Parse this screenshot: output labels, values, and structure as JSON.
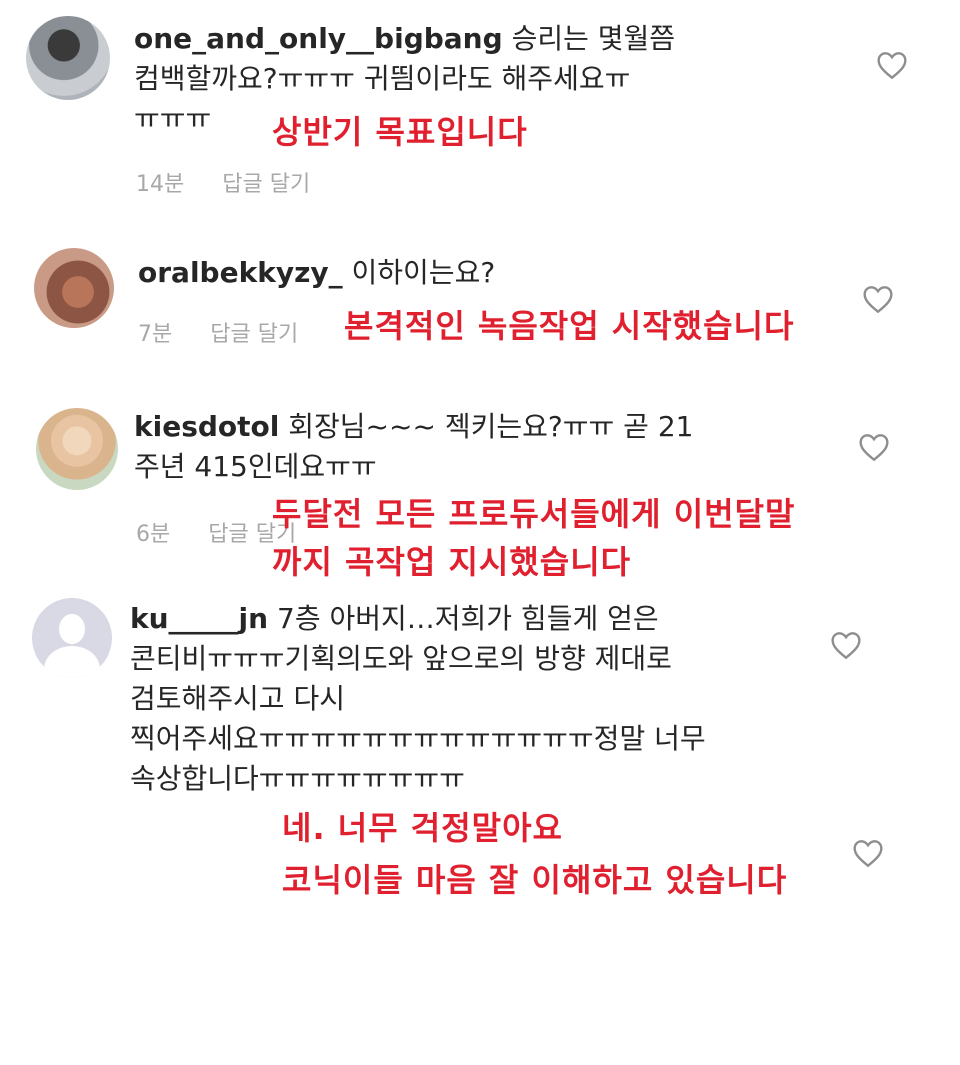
{
  "comments": [
    {
      "username": "one_and_only__bigbang",
      "text_line1": "승리는 몇월쯤",
      "text_line2": "컴백할까요?ㅠㅠㅠ 귀띔이라도 해주세요ㅠ",
      "text_line3": "ㅠㅠㅠ",
      "time": "14분",
      "reply_label": "답글 달기",
      "annotation": "상반기 목표입니다"
    },
    {
      "username": "oralbekkyzy_",
      "text_line1": "이하이는요?",
      "time": "7분",
      "reply_label": "답글 달기",
      "annotation": "본격적인 녹음작업 시작했습니다"
    },
    {
      "username": "kiesdotol",
      "text_line1": "회장님~~~ 젝키는요?ㅠㅠ 곧 21",
      "text_line2": "주년 415인데요ㅠㅠ",
      "time": "6분",
      "reply_label": "답글 달기",
      "annotation_line1": "두달전 모든 프로듀서들에게 이번달말",
      "annotation_line2": "까지 곡작업 지시했습니다"
    },
    {
      "username": "ku_____jn",
      "text_line1": "7층 아버지…저희가 힘들게 얻은",
      "text_line2": "콘티비ㅠㅠㅠ기획의도와 앞으로의 방향 제대로",
      "text_line3": "검토해주시고 다시",
      "text_line4": "찍어주세요ㅠㅠㅠㅠㅠㅠㅠㅠㅠㅠㅠㅠㅠ정말 너무",
      "text_line5": "속상합니다ㅠㅠㅠㅠㅠㅠㅠㅠ",
      "annotation_line1": "네. 너무 걱정말아요",
      "annotation_line2": "코닉이들 마음 잘 이해하고 있습니다"
    }
  ],
  "colors": {
    "annotation": "#e0202f",
    "meta": "#a8a8a8",
    "text": "#262626"
  },
  "icons": [
    "heart-icon"
  ]
}
